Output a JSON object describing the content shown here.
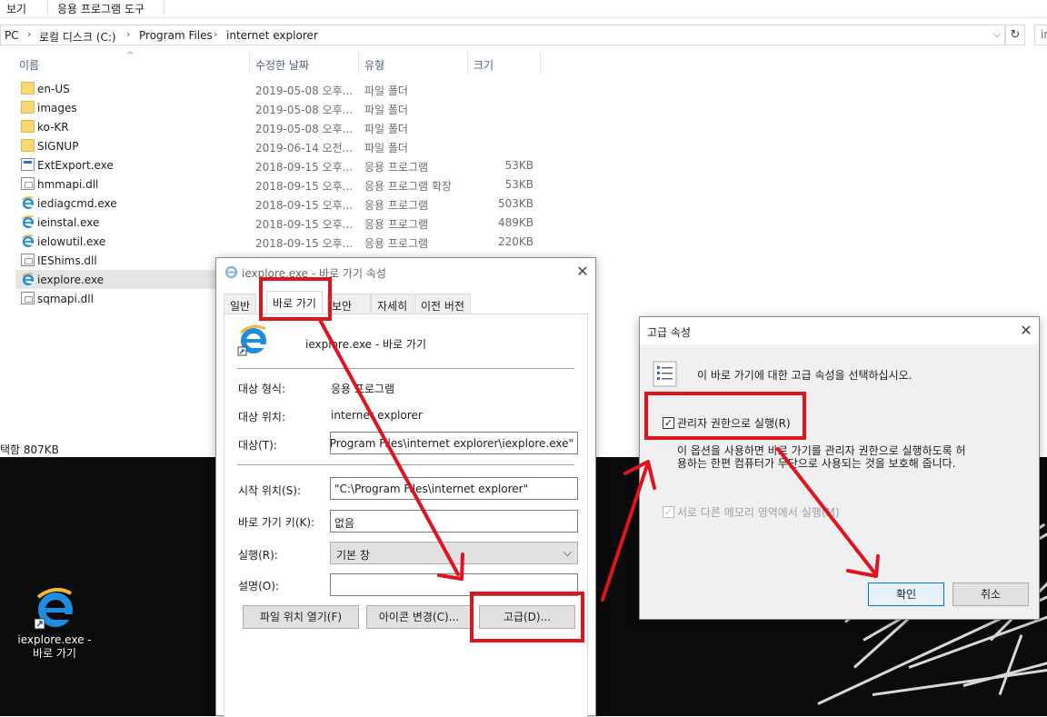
{
  "ribbon": {
    "view_tab": "보기",
    "app_tools_tab": "응용 프로그램 도구"
  },
  "address": {
    "crumbs": [
      "PC",
      "로컬 디스크 (C:)",
      "Program Files",
      "internet explorer"
    ],
    "search_text": "in"
  },
  "columns": {
    "name": "이름",
    "date": "수정한 날짜",
    "type": "유형",
    "size": "크기"
  },
  "files": [
    {
      "name": "en-US",
      "date": "2019-05-08 오후...",
      "type": "파일 폴더",
      "size": "",
      "icon": "folder-icon"
    },
    {
      "name": "images",
      "date": "2019-05-08 오후...",
      "type": "파일 폴더",
      "size": "",
      "icon": "folder-icon"
    },
    {
      "name": "ko-KR",
      "date": "2019-05-08 오후...",
      "type": "파일 폴더",
      "size": "",
      "icon": "folder-icon"
    },
    {
      "name": "SIGNUP",
      "date": "2019-06-14 오전...",
      "type": "파일 폴더",
      "size": "",
      "icon": "folder-icon"
    },
    {
      "name": "ExtExport.exe",
      "date": "2018-09-15 오후...",
      "type": "응용 프로그램",
      "size": "53KB",
      "icon": "exe-icon"
    },
    {
      "name": "hmmapi.dll",
      "date": "2018-09-15 오후...",
      "type": "응용 프로그램 확장",
      "size": "53KB",
      "icon": "dll-icon"
    },
    {
      "name": "iediagcmd.exe",
      "date": "2018-09-15 오후...",
      "type": "응용 프로그램",
      "size": "503KB",
      "icon": "ie-icon"
    },
    {
      "name": "ieinstal.exe",
      "date": "2018-09-15 오후...",
      "type": "응용 프로그램",
      "size": "489KB",
      "icon": "ie-icon"
    },
    {
      "name": "ielowutil.exe",
      "date": "2018-09-15 오후...",
      "type": "응용 프로그램",
      "size": "220KB",
      "icon": "ie-icon"
    },
    {
      "name": "IEShims.dll",
      "date": "",
      "type": "",
      "size": "",
      "icon": "dll-icon"
    },
    {
      "name": "iexplore.exe",
      "date": "",
      "type": "",
      "size": "",
      "icon": "ie-icon"
    },
    {
      "name": "sqmapi.dll",
      "date": "",
      "type": "",
      "size": "",
      "icon": "dll-icon"
    }
  ],
  "statusbar": {
    "text": "택함 807KB"
  },
  "desktop": {
    "icon_label_line1": "iexplore.exe -",
    "icon_label_line2": "바로 가기"
  },
  "props_dialog": {
    "title": "iexplore.exe - 바로 가기 속성",
    "tabs": [
      "일반",
      "바로 가기",
      "보안",
      "자세히",
      "이전 버전"
    ],
    "header_name": "iexplore.exe - 바로 가기",
    "target_type_label": "대상 형식:",
    "target_type_value": "응용 프로그램",
    "target_location_label": "대상 위치:",
    "target_location_value": "internet explorer",
    "target_label": "대상(T):",
    "target_value": "C:\\Program Files\\internet explorer\\iexplore.exe\"",
    "start_in_label": "시작 위치(S):",
    "start_in_value": "\"C:\\Program Files\\internet explorer\"",
    "shortcut_key_label": "바로 가기 키(K):",
    "shortcut_key_value": "없음",
    "run_label": "실행(R):",
    "run_value": "기본 창",
    "comment_label": "설명(O):",
    "comment_value": "",
    "open_location_button": "파일 위치 열기(F)",
    "change_icon_button": "아이콘 변경(C)...",
    "advanced_button": "고급(D)..."
  },
  "advanced_dialog": {
    "title": "고급 속성",
    "description": "이 바로 가기에 대한 고급 속성을 선택하십시오.",
    "run_as_admin_label": "관리자 권한으로 실행(R)",
    "run_as_admin_checked": true,
    "info_line1": "이 옵션을 사용하면 바로 가기를 관리자 권한으로 실행하도록 허",
    "info_line2": "용하는 한편 컴퓨터가 무단으로 사용되는 것을 보호해 줍니다.",
    "separate_memory_label": "서로 다른 메모리 영역에서 실행(M)",
    "ok_button": "확인",
    "cancel_button": "취소"
  },
  "colors": {
    "annotation": "#e0141e",
    "accent": "#0078d7",
    "desktop": "#0b0b0b"
  }
}
